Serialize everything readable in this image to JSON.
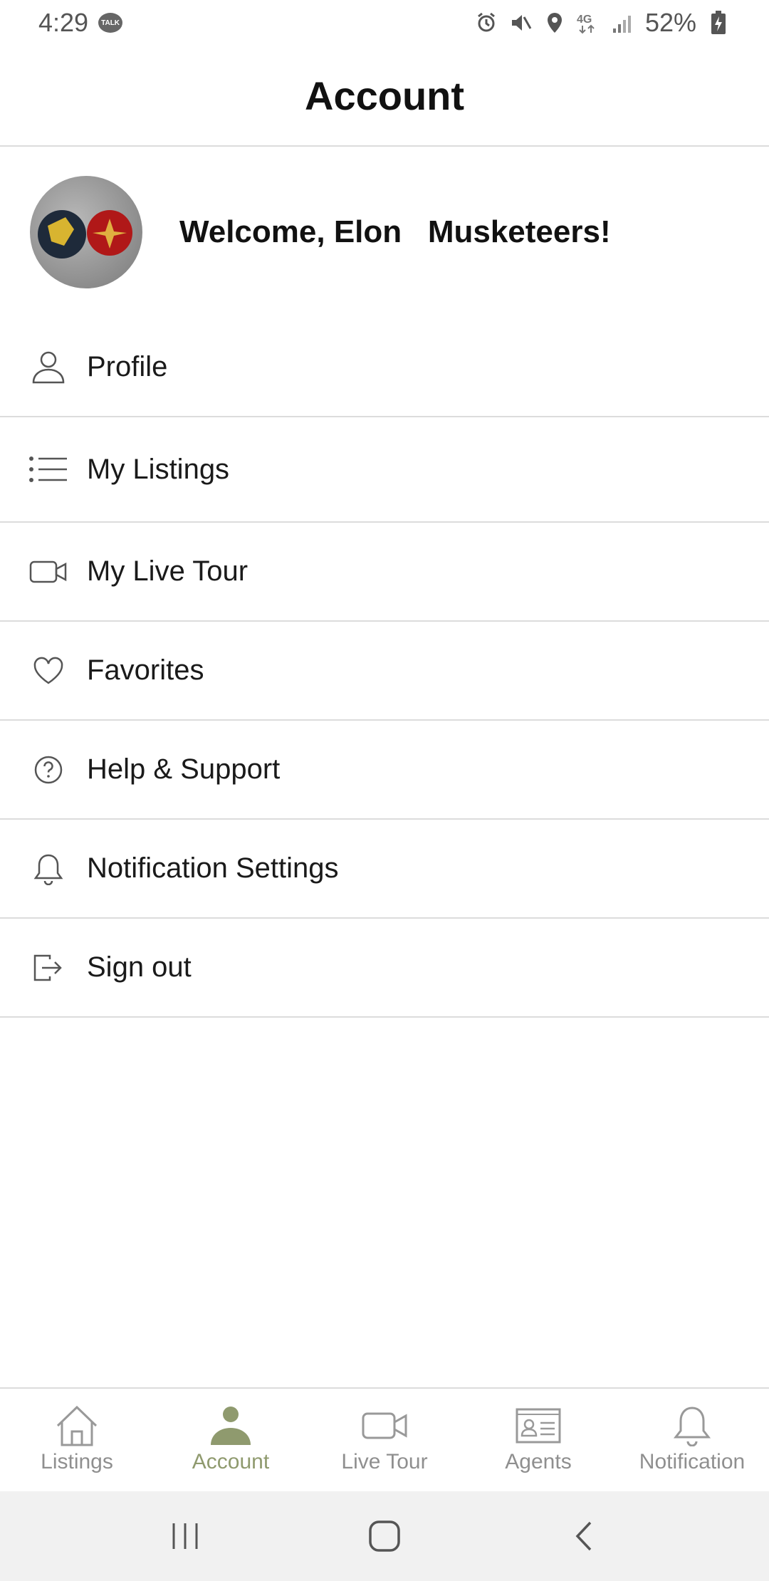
{
  "status_bar": {
    "time": "4:29",
    "talk_badge": "TALK",
    "battery": "52%"
  },
  "header": {
    "title": "Account"
  },
  "welcome": {
    "text": "Welcome, Elon   Musketeers!"
  },
  "menu": {
    "items": [
      {
        "label": "Profile",
        "icon": "person-icon"
      },
      {
        "label": "My Listings",
        "icon": "list-icon"
      },
      {
        "label": "My Live Tour",
        "icon": "video-camera-icon"
      },
      {
        "label": "Favorites",
        "icon": "heart-icon"
      },
      {
        "label": "Help & Support",
        "icon": "help-circle-icon"
      },
      {
        "label": "Notification Settings",
        "icon": "bell-icon"
      },
      {
        "label": "Sign out",
        "icon": "sign-out-icon"
      }
    ]
  },
  "bottom_nav": {
    "active": "Account",
    "active_color": "#8f9a6e",
    "items": [
      {
        "label": "Listings",
        "icon": "home-icon"
      },
      {
        "label": "Account",
        "icon": "person-filled-icon"
      },
      {
        "label": "Live Tour",
        "icon": "video-camera-icon"
      },
      {
        "label": "Agents",
        "icon": "id-card-icon"
      },
      {
        "label": "Notification",
        "icon": "bell-icon"
      }
    ]
  },
  "system_nav": {
    "items": [
      "recent-apps-icon",
      "home-button-icon",
      "back-icon"
    ]
  }
}
